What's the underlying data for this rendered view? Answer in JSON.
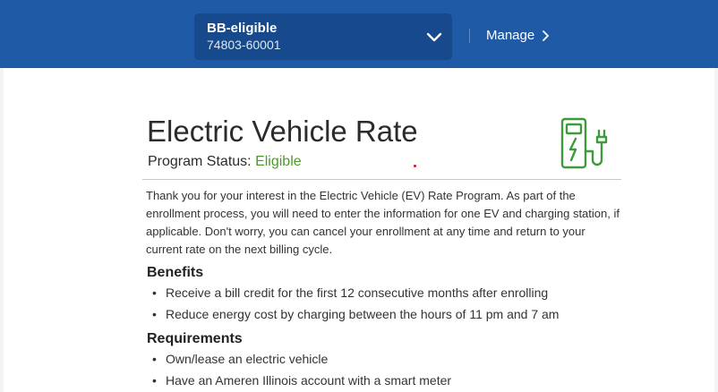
{
  "header": {
    "account_name": "BB-eligible",
    "account_number": "74803-60001",
    "manage_label": "Manage",
    "brand_color": "#1f5aa6"
  },
  "program": {
    "title": "Electric Vehicle Rate",
    "status_label": "Program Status:",
    "status_value": "Eligible",
    "status_color": "#4c9a2a",
    "icon": "ev-charger-icon",
    "intro": "Thank you for your interest in the Electric Vehicle (EV) Rate Program. As part of the enrollment process, you will need to enter the information for one EV and charging station, if applicable. Don't worry, you can cancel your enrollment at any time and return to your current rate on the next billing cycle."
  },
  "benefits": {
    "heading": "Benefits",
    "items": [
      "Receive a bill credit for the first 12 consecutive months after enrolling",
      "Reduce energy cost by charging between the hours of 11 pm and 7 am"
    ]
  },
  "requirements": {
    "heading": "Requirements",
    "items": [
      "Own/lease an electric vehicle",
      "Have an Ameren Illinois account with a smart meter"
    ]
  }
}
